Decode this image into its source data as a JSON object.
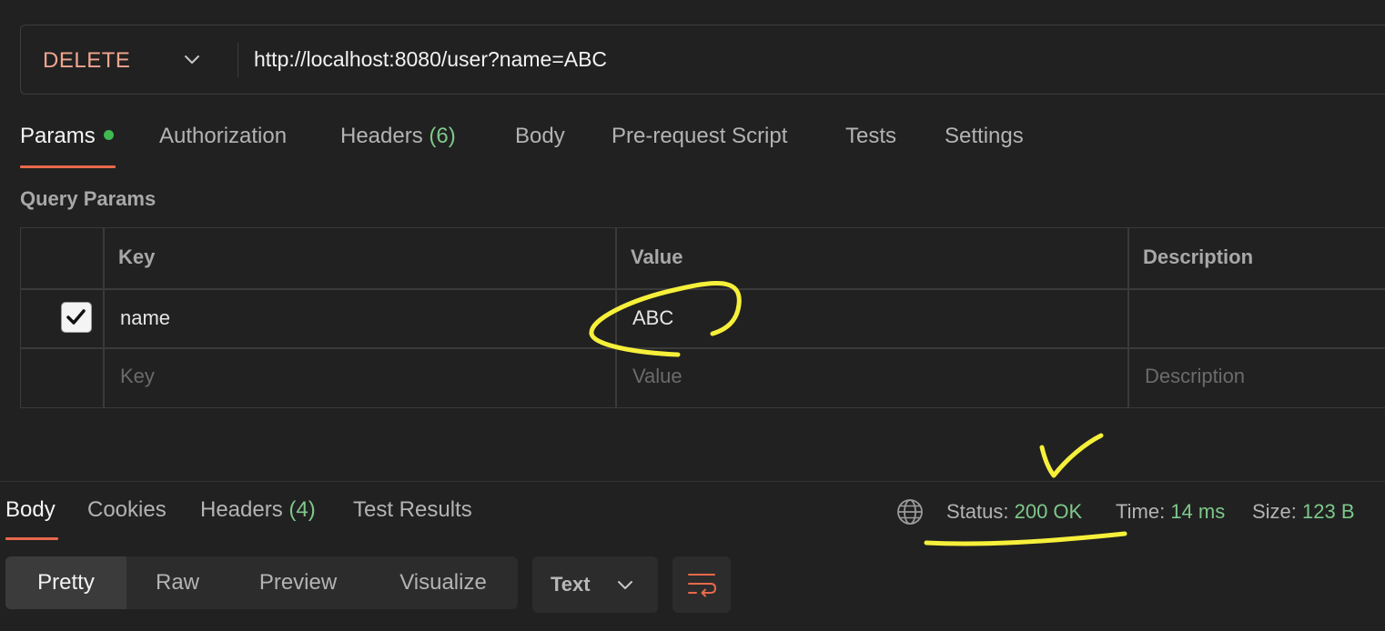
{
  "request": {
    "method": "DELETE",
    "url": "http://localhost:8080/user?name=ABC"
  },
  "tabs": [
    {
      "label": "Params",
      "active": true
    },
    {
      "label": "Authorization"
    },
    {
      "label": "Headers",
      "count": "(6)"
    },
    {
      "label": "Body"
    },
    {
      "label": "Pre-request Script"
    },
    {
      "label": "Tests"
    },
    {
      "label": "Settings"
    }
  ],
  "query_params": {
    "title": "Query Params",
    "headers": [
      "Key",
      "Value",
      "Description"
    ],
    "rows": [
      {
        "checked": true,
        "key": "name",
        "value": "ABC",
        "description": ""
      }
    ],
    "placeholders": {
      "key": "Key",
      "value": "Value",
      "description": "Description"
    }
  },
  "response": {
    "tabs": [
      {
        "label": "Body",
        "active": true
      },
      {
        "label": "Cookies"
      },
      {
        "label": "Headers",
        "count": "(4)"
      },
      {
        "label": "Test Results"
      }
    ],
    "status_label": "Status:",
    "status_value": "200 OK",
    "time_label": "Time:",
    "time_value": "14 ms",
    "size_label": "Size:",
    "size_value": "123 B",
    "views": [
      "Pretty",
      "Raw",
      "Preview",
      "Visualize"
    ],
    "active_view": "Pretty",
    "format": "Text"
  },
  "colors": {
    "background": "#212121",
    "method": "#f0a58f",
    "accent": "#e8694a",
    "success": "#7ec88b",
    "annotation": "#f6f03a"
  },
  "icons": [
    "chevron-down-icon",
    "checkmark-icon",
    "globe-icon",
    "wrap-lines-icon"
  ]
}
